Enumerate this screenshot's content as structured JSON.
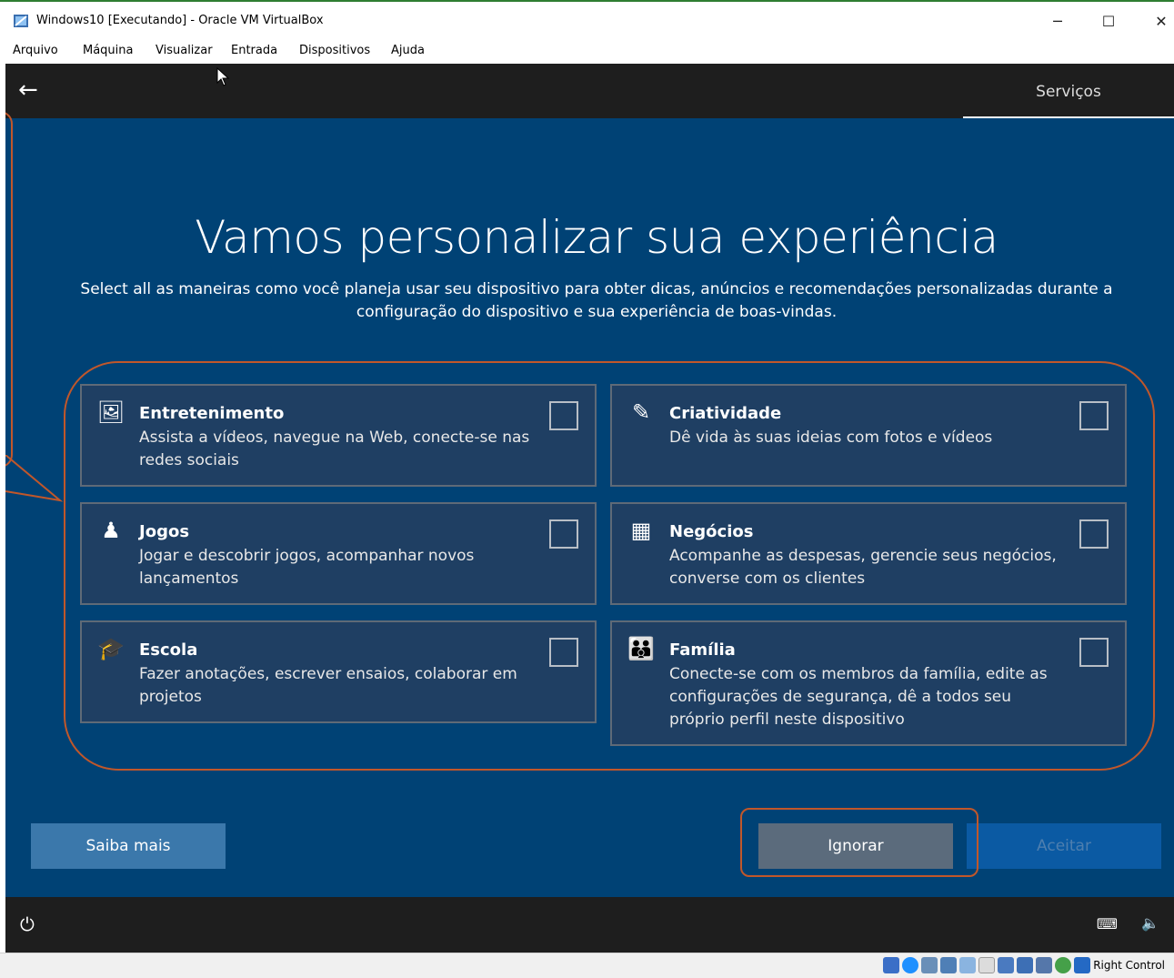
{
  "window": {
    "title": "Windows10 [Executando] - Oracle VM VirtualBox",
    "controls": {
      "minimize": "─",
      "maximize": "☐",
      "close": "✕"
    }
  },
  "menubar": [
    "Arquivo",
    "Máquina",
    "Visualizar",
    "Entrada",
    "Dispositivos",
    "Ajuda"
  ],
  "oobe": {
    "back_icon": "←",
    "tab": "Serviços",
    "heading": "Vamos personalizar sua experiência",
    "subtitle": "Select all as maneiras como você planeja usar seu dispositivo para obter dicas, anúncios e recomendações personalizadas durante a configuração do dispositivo e sua experiência de boas-vindas.",
    "cards": [
      {
        "title": "Entretenimento",
        "desc": "Assista a vídeos, navegue na Web, conecte-se nas redes sociais",
        "icon": "entertainment-icon",
        "glyph": "🖼",
        "checked": false
      },
      {
        "title": "Criatividade",
        "desc": "Dê vida às suas ideias com fotos e vídeos",
        "icon": "creativity-icon",
        "glyph": "✎",
        "checked": false
      },
      {
        "title": "Jogos",
        "desc": "Jogar e descobrir jogos, acompanhar novos lançamentos",
        "icon": "gaming-icon",
        "glyph": "♟",
        "checked": false
      },
      {
        "title": "Negócios",
        "desc": "Acompanhe as despesas, gerencie seus negócios, converse com os clientes",
        "icon": "business-icon",
        "glyph": "▦",
        "checked": false
      },
      {
        "title": "Escola",
        "desc": "Fazer anotações, escrever ensaios, colaborar em projetos",
        "icon": "school-icon",
        "glyph": "🎓",
        "checked": false
      },
      {
        "title": "Família",
        "desc": "Conecte-se com os membros da família, edite as configurações de segurança, dê a todos seu próprio perfil neste dispositivo",
        "icon": "family-icon",
        "glyph": "👪",
        "checked": false
      }
    ],
    "buttons": {
      "learn_more": "Saiba mais",
      "skip": "Ignorar",
      "accept": "Aceitar"
    },
    "bottom": {
      "ease_icon": "⏻",
      "keyboard_icon": "⌨",
      "volume_icon": "🔈"
    }
  },
  "statusbar": {
    "host_key": "Right Control"
  },
  "colors": {
    "vm_bg": "#004275",
    "annotation": "#c1572a",
    "card_bg": "#1f3f63"
  }
}
